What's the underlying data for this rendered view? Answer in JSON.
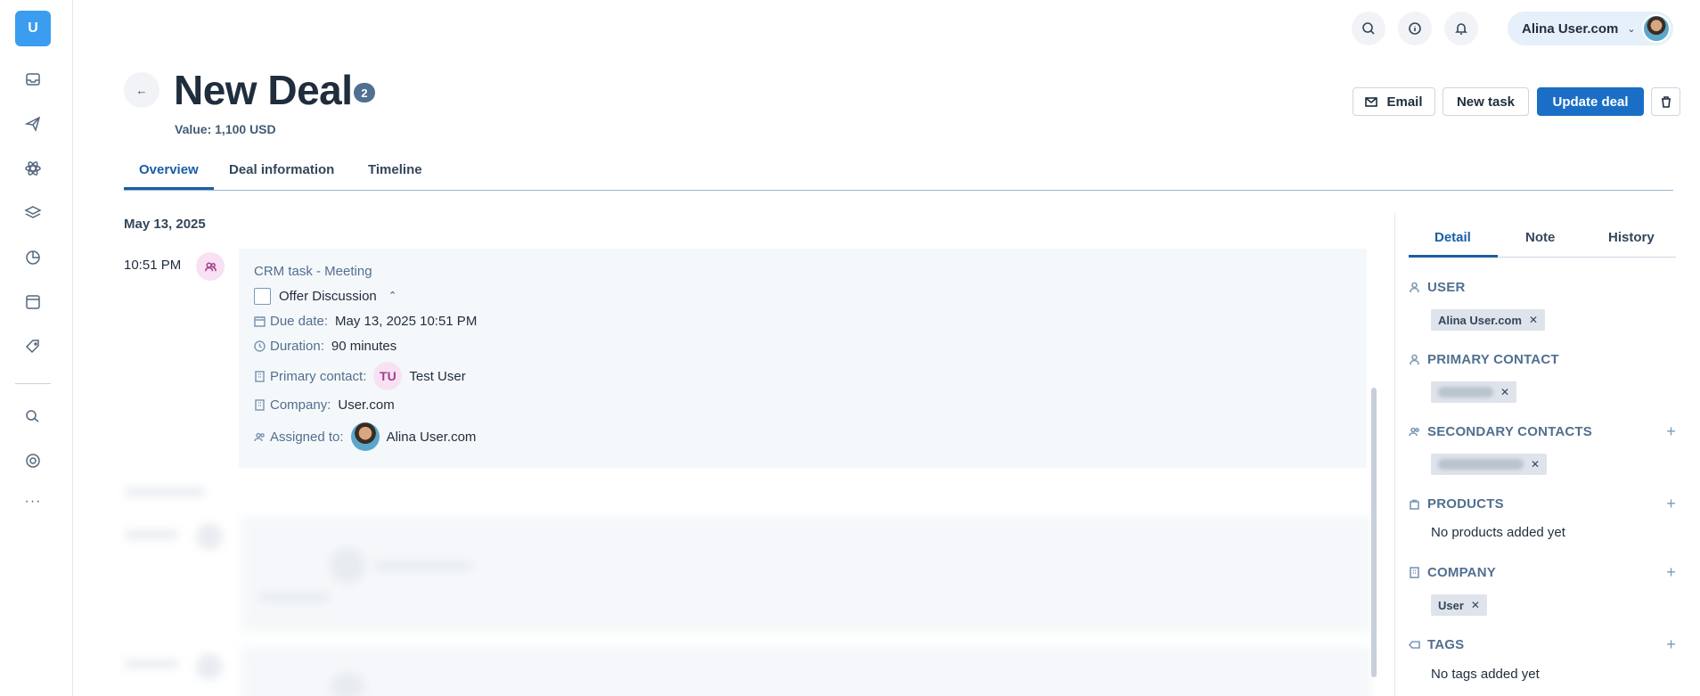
{
  "rail": {
    "logo": "U",
    "icons": [
      "inbox-icon",
      "send-icon",
      "atom-icon",
      "layers-icon",
      "pie-chart-icon",
      "browser-window-icon",
      "tag-icon",
      "handshake-icon",
      "support-icon"
    ],
    "more": "···"
  },
  "topbar": {
    "user_name": "Alina User.com",
    "caret": "⌄"
  },
  "header": {
    "title": "New Deal",
    "badge": "2",
    "value_label": "Value:",
    "value_amount": "1,100 USD",
    "buttons": {
      "email": "Email",
      "new_task": "New task",
      "update": "Update deal"
    }
  },
  "tabs": [
    "Overview",
    "Deal information",
    "Timeline"
  ],
  "timeline": {
    "date": "May 13, 2025",
    "time": "10:51 PM",
    "card": {
      "title": "CRM task - Meeting",
      "task_name": "Offer Discussion",
      "caret": "⌃",
      "due_label": "Due date:",
      "due_value": "May 13, 2025 10:51 PM",
      "duration_label": "Duration:",
      "duration_value": "90 minutes",
      "contact_label": "Primary contact:",
      "contact_initials": "TU",
      "contact_name": "Test User",
      "company_label": "Company:",
      "company_value": "User.com",
      "assigned_label": "Assigned to:",
      "assigned_name": "Alina User.com"
    }
  },
  "right_panel": {
    "tabs": [
      "Detail",
      "Note",
      "History"
    ],
    "sections": {
      "user": {
        "heading": "USER",
        "tag": "Alina User.com"
      },
      "primary_contact": {
        "heading": "PRIMARY CONTACT"
      },
      "secondary_contacts": {
        "heading": "SECONDARY CONTACTS"
      },
      "products": {
        "heading": "PRODUCTS",
        "empty": "No products added yet"
      },
      "company": {
        "heading": "COMPANY",
        "tag": "User"
      },
      "tags": {
        "heading": "TAGS",
        "empty": "No tags added yet"
      }
    },
    "remove_glyph": "✕",
    "add_glyph": "+"
  },
  "colors": {
    "brand_blue": "#1a6ec5",
    "logo_blue": "#3a9df0",
    "meeting_pink": "#f8e1f3"
  }
}
